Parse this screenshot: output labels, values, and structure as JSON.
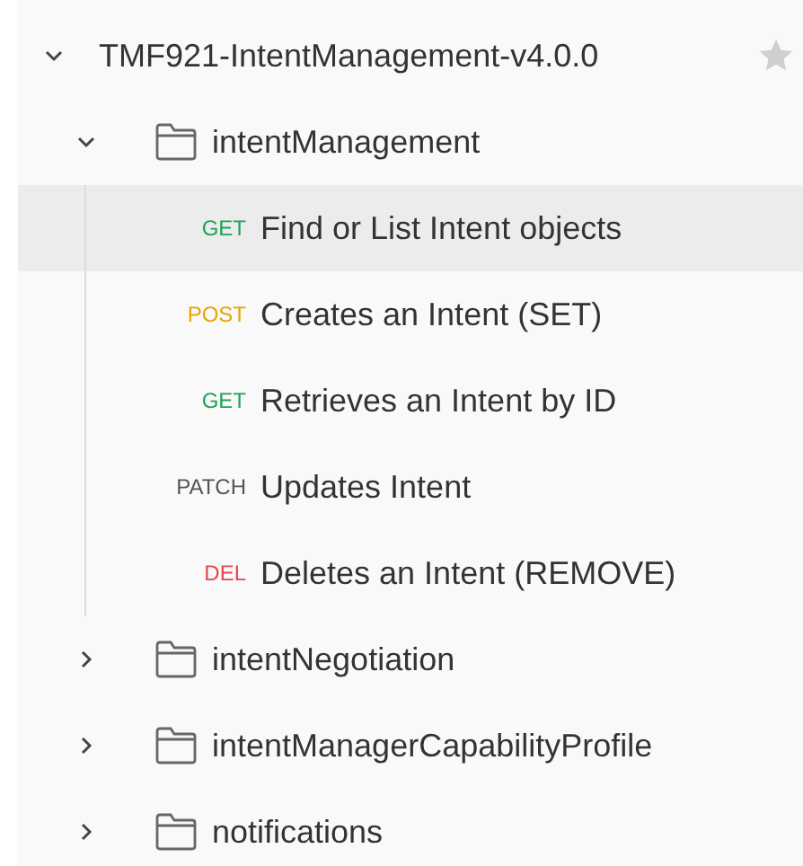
{
  "collection": {
    "name": "TMF921-IntentManagement-v4.0.0",
    "expanded": true,
    "starred": false
  },
  "folders": [
    {
      "name": "intentManagement",
      "expanded": true,
      "requests": [
        {
          "method": "GET",
          "color": "#1fa355",
          "name": "Find or List Intent objects",
          "selected": true
        },
        {
          "method": "POST",
          "color": "#e8a400",
          "name": "Creates an Intent (SET)",
          "selected": false
        },
        {
          "method": "GET",
          "color": "#1fa355",
          "name": "Retrieves an Intent by ID",
          "selected": false
        },
        {
          "method": "PATCH",
          "color": "#555555",
          "name": "Updates Intent",
          "selected": false
        },
        {
          "method": "DEL",
          "color": "#e5484d",
          "name": "Deletes an Intent (REMOVE)",
          "selected": false
        }
      ]
    },
    {
      "name": "intentNegotiation",
      "expanded": false
    },
    {
      "name": "intentManagerCapabilityProfile",
      "expanded": false
    },
    {
      "name": "notifications",
      "expanded": false
    }
  ]
}
